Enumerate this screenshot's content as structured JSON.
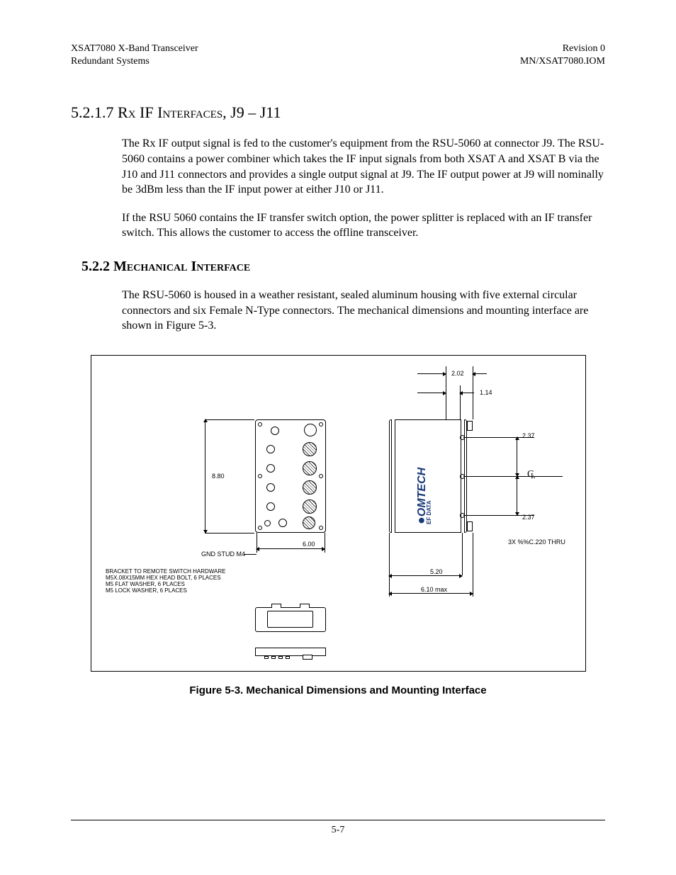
{
  "header": {
    "left_line1": "XSAT7080 X-Band Transceiver",
    "left_line2": "Redundant Systems",
    "right_line1": "Revision 0",
    "right_line2": "MN/XSAT7080.IOM"
  },
  "sections": {
    "s1": {
      "number": "5.2.1.7",
      "title_a": "R",
      "title_b": "x",
      "title_c": " IF I",
      "title_d": "nterfaces",
      "title_e": ", J9 – J11"
    },
    "p1": "The Rx IF output signal is fed to the customer's equipment from the RSU-5060 at connector J9. The RSU-5060 contains a power combiner which takes the IF input signals from both XSAT A and XSAT B via the J10 and J11 connectors and provides a single output signal at J9.  The IF output power at J9 will nominally be 3dBm less than the IF input power at either J10 or J11.",
    "p2": "If the RSU 5060 contains the IF transfer switch option, the power splitter is replaced with an IF transfer switch.  This allows the customer to access the offline transceiver.",
    "s2": {
      "number": "5.2.2",
      "title": "Mechanical Interface"
    },
    "p3": "The RSU-5060 is housed in a weather resistant, sealed aluminum housing with five external circular connectors and six Female N-Type connectors.  The mechanical dimensions and mounting interface are shown in Figure 5-3."
  },
  "figure": {
    "caption": "Figure 5-3.  Mechanical Dimensions and Mounting Interface",
    "dims": {
      "d_2_02": "2.02",
      "d_1_14": "1.14",
      "d_2_37a": "2.37",
      "d_2_37b": "2.37",
      "d_8_80": "8.80",
      "d_6_00": "6.00",
      "d_5_20": "5.20",
      "d_6_10": "6.10 max"
    },
    "labels": {
      "gnd": "GND STUD M4",
      "thru": "3X %%C.220 THRU",
      "cl": "C L",
      "bracket1": "BRACKET TO REMOTE SWITCH HARDWARE",
      "bracket2": "M5X.08X15MM HEX HEAD BOLT, 6 PLACES",
      "bracket3": "M5 FLAT WASHER, 6 PLACES",
      "bracket4": "M5 LOCK WASHER, 6 PLACES",
      "logo_main": "OMTECH",
      "logo_sub": "EF DATA"
    }
  },
  "footer": {
    "page": "5-7"
  }
}
